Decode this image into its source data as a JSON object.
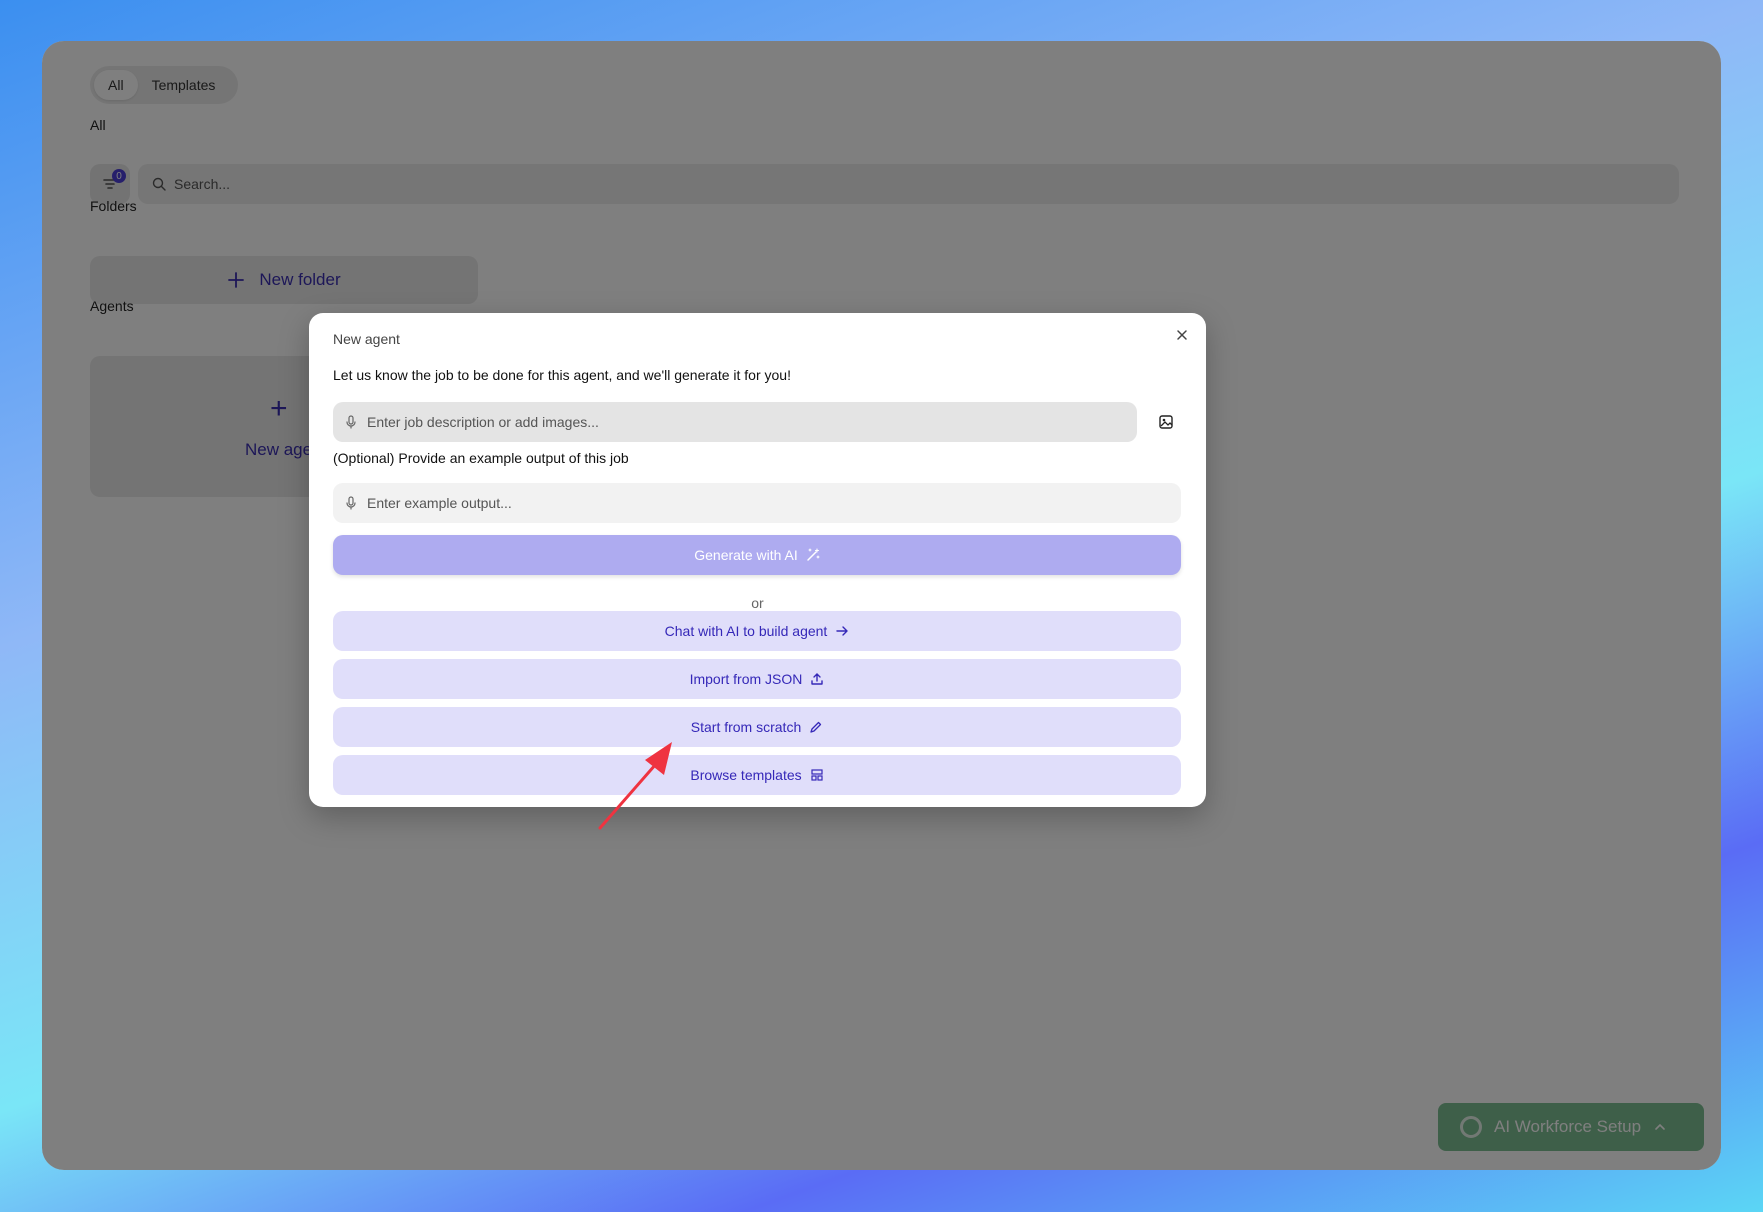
{
  "tabs": [
    {
      "label": "All",
      "active": true
    },
    {
      "label": "Templates",
      "active": false
    }
  ],
  "section_all": "All",
  "filter_count": "0",
  "search": {
    "placeholder": "Search..."
  },
  "folders": {
    "title": "Folders",
    "new_folder_label": "New folder"
  },
  "agents": {
    "title": "Agents",
    "new_agent_label": "New agent"
  },
  "dialog": {
    "title": "New agent",
    "prompt": "Let us know the job to be done for this agent, and we'll generate it for you!",
    "job_placeholder": "Enter job description or add images...",
    "optional_label": "(Optional) Provide an example output of this job",
    "example_placeholder": "Enter example output...",
    "generate_label": "Generate with AI",
    "or_label": "or",
    "chat_label": "Chat with AI to build agent",
    "import_label": "Import from JSON",
    "scratch_label": "Start from scratch",
    "browse_label": "Browse templates"
  },
  "workforce": {
    "label": "AI Workforce Setup"
  },
  "colors": {
    "accent": "#3528b8",
    "primary_button": "#aeabf0",
    "secondary_button": "#e0defa",
    "workforce_green": "#138a3a",
    "arrow": "#ef3340"
  }
}
